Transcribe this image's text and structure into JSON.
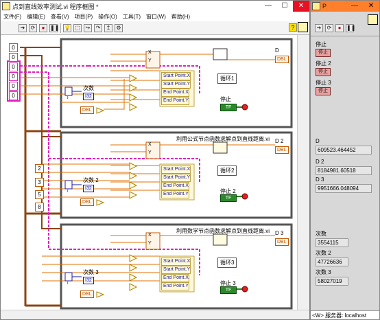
{
  "diagram_window": {
    "title": "点到直线效率测试.vi 程序框图 *",
    "menu": [
      "文件(F)",
      "编辑(E)",
      "查看(V)",
      "项目(P)",
      "操作(O)",
      "工具(T)",
      "窗口(W)",
      "帮助(H)"
    ],
    "help_label": "?"
  },
  "panel_window": {
    "title": "P",
    "controls": {
      "stop1_label": "停止",
      "stop2_label": "停止 2",
      "stop3_label": "停止 3",
      "stop_button_text": "停止",
      "d_label": "D",
      "d_value": "609523.464452",
      "d2_label": "D 2",
      "d2_value": "8184981.60518",
      "d3_label": "D 3",
      "d3_value": "9951666.048094",
      "c1_label": "次数",
      "c1_value": "3554115",
      "c2_label": "次数 2",
      "c2_value": "47726636",
      "c3_label": "次数 3",
      "c3_value": "58027019"
    },
    "status": "<W> 服务器: localhost"
  },
  "diagram": {
    "top_consts": [
      "0",
      "0"
    ],
    "left_array": [
      "0",
      "0",
      "0",
      "0"
    ],
    "mid_consts": [
      "2",
      "3",
      "5",
      "8"
    ],
    "loop1": {
      "name": "循环1",
      "count": "次数",
      "d": "D",
      "stop": "停止"
    },
    "loop2": {
      "name": "循环2",
      "count": "次数 2",
      "d": "D 2",
      "stop": "停止 2",
      "note": "利用公式节点函数求解点到直线距离.vi"
    },
    "loop3": {
      "name": "循环3",
      "count": "次数 3",
      "d": "D 3",
      "stop": "停止 3",
      "note": "利用数学节点函数求解点到直线距离.vi"
    },
    "props": [
      "Start Point.X",
      "Start Point.Y",
      "End Point.X",
      "End Point.Y"
    ],
    "xy": [
      "X",
      "Y"
    ],
    "dbl": "DBL",
    "i32": "I32",
    "i": "i",
    "tf": "TF"
  }
}
